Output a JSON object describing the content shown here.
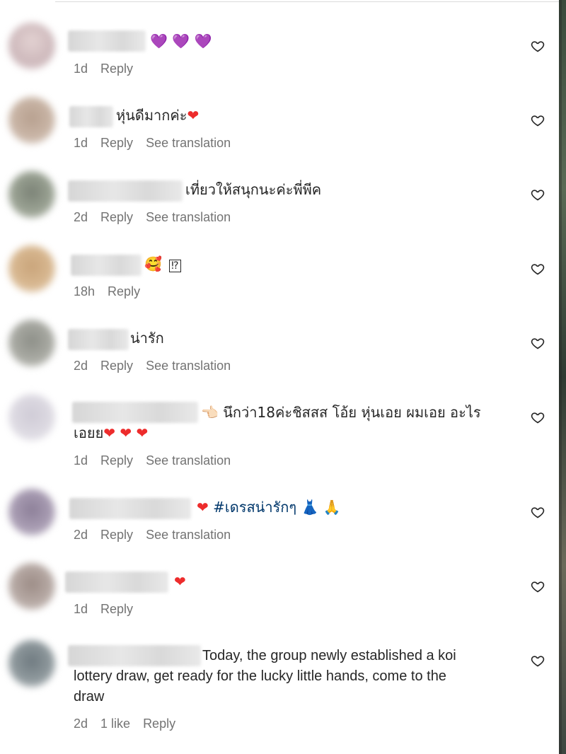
{
  "comments": [
    {
      "text_parts": {
        "a": "",
        "hearts": "💜 💜 💜"
      },
      "time": "1d",
      "reply": "Reply",
      "translate": ""
    },
    {
      "text_parts": {
        "a": "หุ่นดีมากค่ะ",
        "hearts": "❤"
      },
      "time": "1d",
      "reply": "Reply",
      "translate": "See translation"
    },
    {
      "text_parts": {
        "a": "เที่ยวให้สนุกนะค่ะพี่พีค"
      },
      "time": "2d",
      "reply": "Reply",
      "translate": "See translation"
    },
    {
      "text_parts": {
        "a": "🥰",
        "b": "⁉"
      },
      "time": "18h",
      "reply": "Reply",
      "translate": ""
    },
    {
      "text_parts": {
        "a": "น่ารัก"
      },
      "time": "2d",
      "reply": "Reply",
      "translate": "See translation"
    },
    {
      "text_parts": {
        "a": "👈🏻 นึกว่า18ค่ะชิสสส โอ้ย หุ่นเอย ผมเอย อะไร",
        "b": "เอยย",
        "hearts": "❤ ❤ ❤"
      },
      "time": "1d",
      "reply": "Reply",
      "translate": "See translation"
    },
    {
      "text_parts": {
        "heart": "❤",
        "hashtag": "#เดรสน่ารักๆ",
        "b": "👗 🙏"
      },
      "time": "2d",
      "reply": "Reply",
      "translate": "See translation"
    },
    {
      "text_parts": {
        "hearts": "❤"
      },
      "time": "1d",
      "reply": "Reply",
      "translate": ""
    },
    {
      "text_parts": {
        "a": "Today, the group newly established a koi",
        "b": "lottery draw, get ready for the lucky little hands, come to the",
        "c": "draw"
      },
      "time": "2d",
      "likes": "1 like",
      "reply": "Reply",
      "translate": ""
    }
  ],
  "icons": {
    "like": "heart-outline-icon"
  },
  "colors": {
    "meta": "#737373",
    "text": "#262626",
    "heart": "#ed2c2c",
    "hashtag": "#00376b"
  }
}
